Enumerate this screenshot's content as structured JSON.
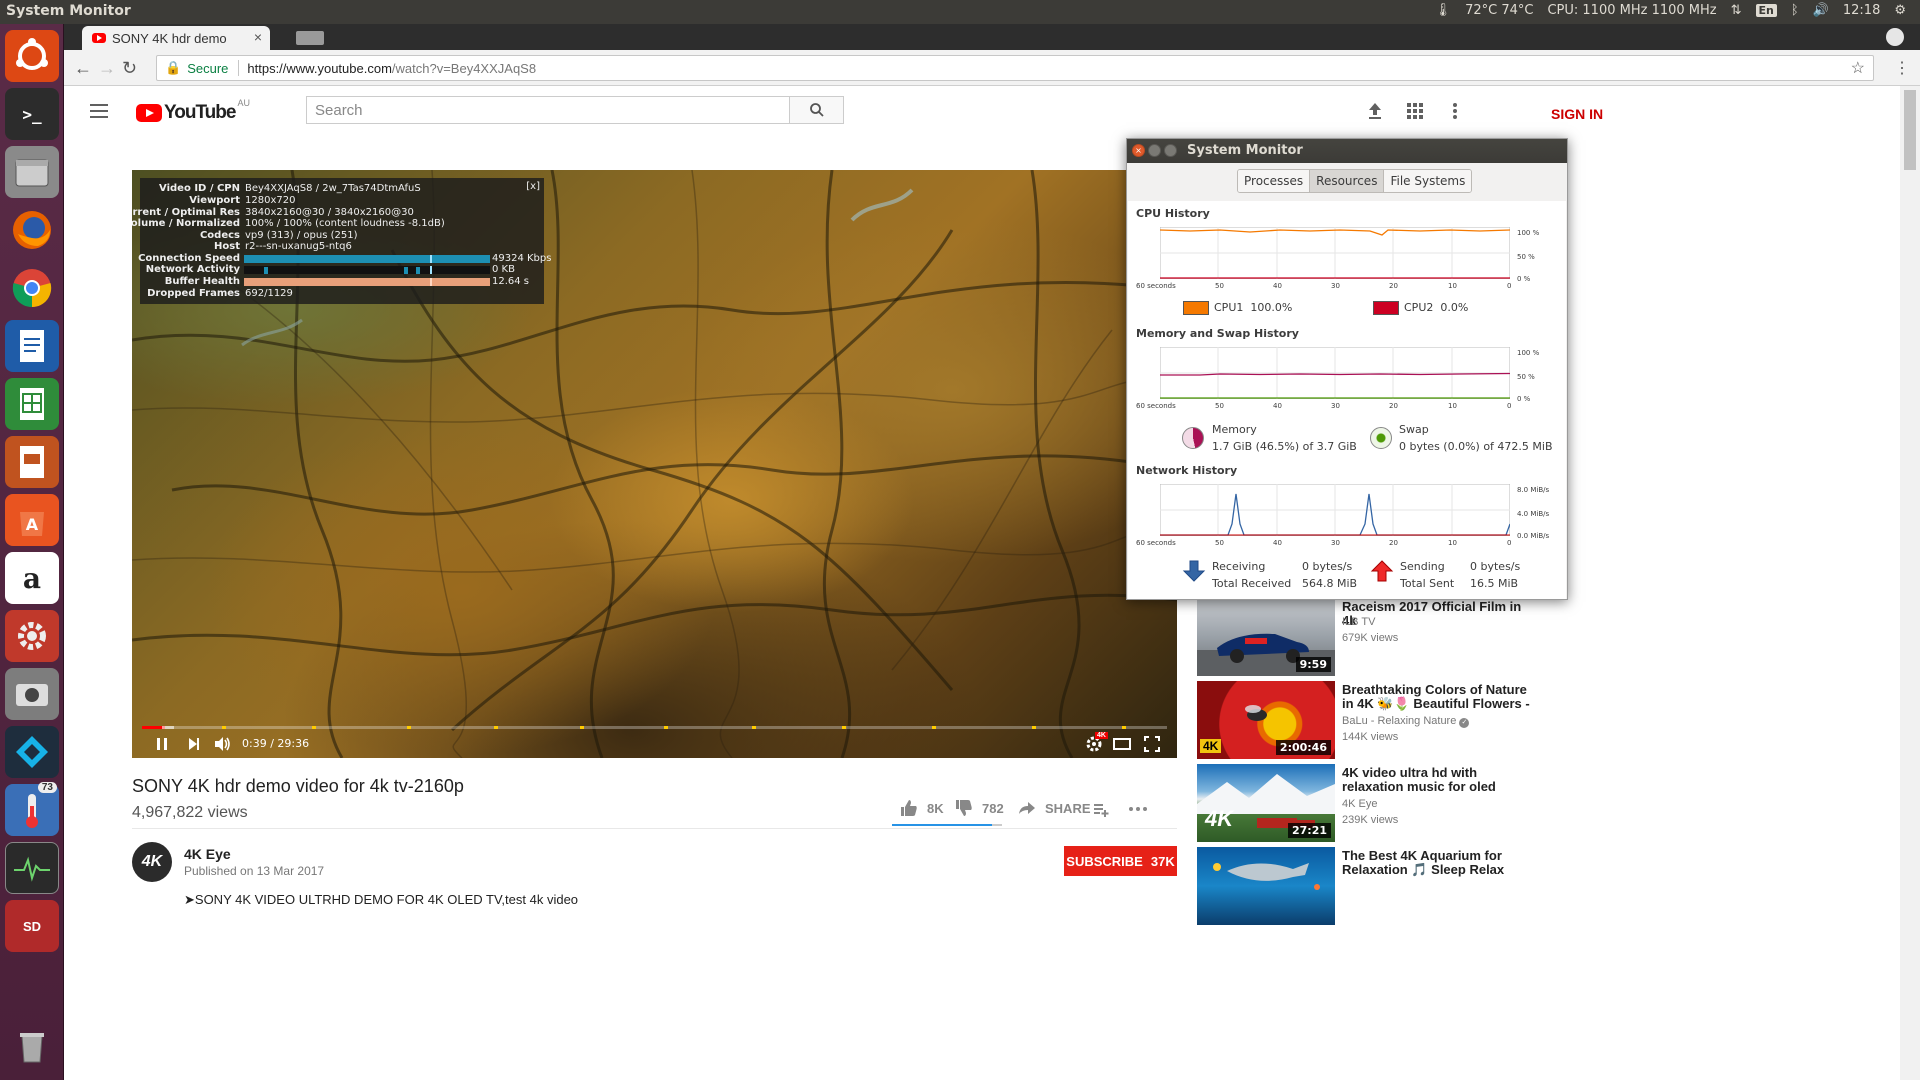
{
  "panel": {
    "app_title": "System Monitor",
    "temps": "72°C 74°C",
    "cpu_freq": "CPU: 1100 MHz 1100 MHz",
    "keyboard": "En",
    "clock": "12:18"
  },
  "launcher": {
    "terminal_label": ">_",
    "amazon_label": "a",
    "sd_label": "SD",
    "badge_count": "73"
  },
  "browser": {
    "tab_title": "SONY 4K hdr demo",
    "tab_close": "×",
    "secure_label": "Secure",
    "url_scheme_host": "https://www.youtube.com",
    "url_path": "/watch?v=Bey4XXJAqS8"
  },
  "youtube": {
    "logo_text": "YouTube",
    "region": "AU",
    "search_placeholder": "Search",
    "sign_in": "SIGN IN"
  },
  "stats_for_nerds": {
    "close": "[x]",
    "rows": [
      {
        "k": "Video ID / CPN",
        "v": "Bey4XXJAqS8 / 2w_7Tas74DtmAfuS"
      },
      {
        "k": "Viewport",
        "v": "1280x720"
      },
      {
        "k": "Current / Optimal Res",
        "v": "3840x2160@30 / 3840x2160@30"
      },
      {
        "k": "Volume / Normalized",
        "v": "100% / 100% (content loudness -8.1dB)"
      },
      {
        "k": "Codecs",
        "v": "vp9 (313) / opus (251)"
      },
      {
        "k": "Host",
        "v": "r2---sn-uxanug5-ntq6"
      },
      {
        "k": "Connection Speed",
        "v": ""
      },
      {
        "k": "Network Activity",
        "v": ""
      },
      {
        "k": "Buffer Health",
        "v": ""
      },
      {
        "k": "Dropped Frames",
        "v": "692/1129"
      }
    ],
    "connection_speed": "49324 Kbps",
    "network_activity": "0 KB",
    "buffer_health": "12.64 s"
  },
  "player": {
    "time_current": "0:39",
    "time_sep": " / ",
    "time_total": "29:36",
    "played_fraction": 0.022,
    "settings_badge": "4K"
  },
  "video": {
    "title": "SONY 4K hdr demo video for 4k tv-2160p",
    "views": "4,967,822 views",
    "likes": "8K",
    "dislikes": "782",
    "share": "SHARE",
    "channel": "4K Eye",
    "channel_avatar_text": "4K",
    "published": "Published on 13 Mar 2017",
    "subscribe_label": "SUBSCRIBE",
    "subscriber_count": "37K",
    "description": "➤SONY 4K VIDEO ULTRHD DEMO FOR 4K OLED TV,test 4k video"
  },
  "recommendations": [
    {
      "title": "Raceism 2017 Official Film in 4k",
      "channel": "ILB TV",
      "views": "679K views",
      "duration": "9:59"
    },
    {
      "title": "Breathtaking Colors of Nature in 4K 🐝🌷 Beautiful Flowers -",
      "channel": "BaLu - Relaxing Nature",
      "views": "144K views",
      "duration": "2:00:46",
      "thumb_badge": "4K"
    },
    {
      "title": "4K video ultra hd with relaxation music for oled",
      "channel": "4K Eye",
      "views": "239K views",
      "duration": "27:21",
      "thumb_badge": "4K"
    },
    {
      "title": "The Best 4K Aquarium for Relaxation 🎵 Sleep Relax",
      "channel": "",
      "views": "",
      "duration": ""
    }
  ],
  "system_monitor": {
    "window_title": "System Monitor",
    "tabs": [
      "Processes",
      "Resources",
      "File Systems"
    ],
    "active_tab": "Resources",
    "cpu_heading": "CPU History",
    "mem_heading": "Memory and Swap History",
    "net_heading": "Network History",
    "x_ticks": [
      "60 seconds",
      "50",
      "40",
      "30",
      "20",
      "10",
      "0"
    ],
    "pct_ticks": [
      "100 %",
      "50 %",
      "0 %"
    ],
    "net_ticks": [
      "8.0 MiB/s",
      "4.0 MiB/s",
      "0.0 MiB/s"
    ],
    "cpu1_label": "CPU1",
    "cpu1_value": "100.0%",
    "cpu2_label": "CPU2",
    "cpu2_value": "0.0%",
    "memory_label": "Memory",
    "memory_value": "1.7 GiB (46.5%) of 3.7 GiB",
    "swap_label": "Swap",
    "swap_value": "0 bytes (0.0%) of 472.5 MiB",
    "receiving_label": "Receiving",
    "receiving_rate": "0 bytes/s",
    "total_received_label": "Total Received",
    "total_received": "564.8 MiB",
    "sending_label": "Sending",
    "sending_rate": "0 bytes/s",
    "total_sent_label": "Total Sent",
    "total_sent": "16.5 MiB",
    "colors": {
      "cpu1": "#f57900",
      "cpu2": "#cc0022",
      "memory": "#aa1155",
      "swap": "#4e9a06",
      "receiving": "#3465a4",
      "sending": "#cc0000"
    }
  }
}
